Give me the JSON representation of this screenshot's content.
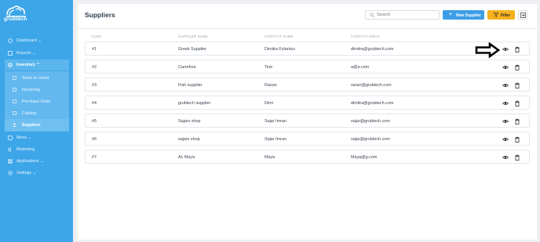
{
  "brand": {
    "name": "grubtech"
  },
  "sidebar": {
    "items": [
      {
        "label": "Dashboard ⌄",
        "icon": "dashboard-icon"
      },
      {
        "label": "Reports ⌄",
        "icon": "reports-icon"
      },
      {
        "label": "Inventory ⌃",
        "icon": "inventory-icon"
      },
      {
        "label": "Menu ⌄",
        "icon": "menu-icon"
      },
      {
        "label": "Marketing",
        "icon": "marketing-icon"
      },
      {
        "label": "Applications ⌄",
        "icon": "applications-icon"
      },
      {
        "label": "Settings ⌄",
        "icon": "settings-icon"
      }
    ],
    "sub_items": [
      {
        "label": "Stock on Hand",
        "icon": "stock-icon"
      },
      {
        "label": "Receiving",
        "icon": "receiving-icon"
      },
      {
        "label": "Purchase Order",
        "icon": "purchase-order-icon"
      },
      {
        "label": "Catalog",
        "icon": "catalog-icon"
      },
      {
        "label": "Suppliers",
        "icon": "suppliers-icon"
      }
    ]
  },
  "header": {
    "title": "Suppliers",
    "search_placeholder": "Search",
    "new_button": "New Supplier",
    "filter_button": "Filter"
  },
  "table": {
    "columns": [
      "CODE",
      "SUPPLIER NAME",
      "CONTACT NAME",
      "CONTACT EMAIL"
    ],
    "rows": [
      {
        "code": "#1",
        "name": "Greek Supplier",
        "contact": "Dimitra Fylantzo",
        "email": "dimitra@grubtech.com"
      },
      {
        "code": "#2",
        "name": "Carrefour",
        "contact": "Test",
        "email": "a@a.com"
      },
      {
        "code": "#3",
        "name": "Fish supplier",
        "contact": "Razan",
        "email": "razan@grubtech.com"
      },
      {
        "code": "#4",
        "name": "grubtech supplier",
        "contact": "Dimi",
        "email": "dimitra@grubtech.com"
      },
      {
        "code": "#5",
        "name": "Sajars shop",
        "contact": "Sajar Imran",
        "email": "sajar@grubtech.com"
      },
      {
        "code": "#6",
        "name": "sajars shop",
        "contact": "Sajar Imran",
        "email": "sajar@grubtech.com"
      },
      {
        "code": "#7",
        "name": "AL Maya",
        "contact": "Maya",
        "email": "Maya@g.com"
      }
    ]
  },
  "colors": {
    "sidebar": "#3da6e8",
    "primary": "#3d9de6",
    "filter": "#f5b21e"
  }
}
